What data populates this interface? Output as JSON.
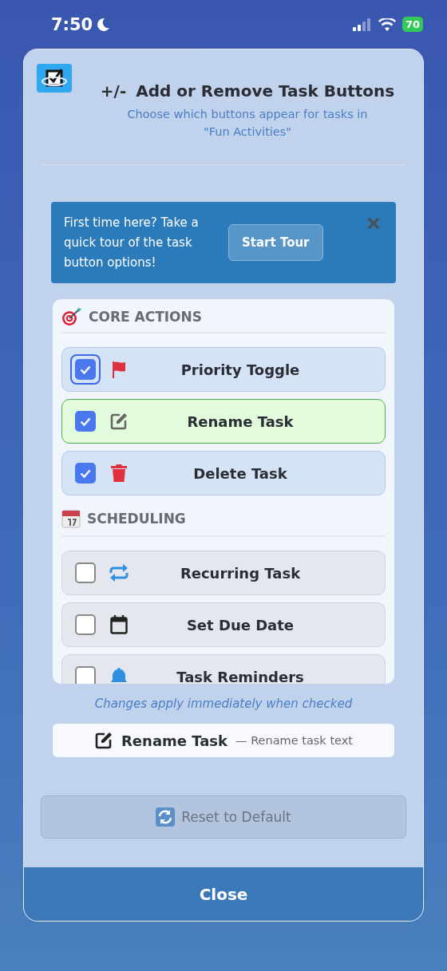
{
  "status_bar": {
    "time": "7:50",
    "battery": "70"
  },
  "dialog": {
    "title_prefix": "+/-",
    "title": "Add or Remove Task Buttons",
    "subtitle": "Choose which buttons appear for tasks in \"Fun Activities\""
  },
  "tour_banner": {
    "text": "First time here? Take a quick tour of the task button options!",
    "button": "Start Tour"
  },
  "sections": [
    {
      "title": "CORE ACTIONS",
      "items": [
        {
          "label": "Priority Toggle",
          "checked": true,
          "selected": false,
          "focused": true
        },
        {
          "label": "Rename Task",
          "checked": true,
          "selected": true,
          "focused": false
        },
        {
          "label": "Delete Task",
          "checked": true,
          "selected": false,
          "focused": false
        }
      ]
    },
    {
      "title": "SCHEDULING",
      "items": [
        {
          "label": "Recurring Task",
          "checked": false,
          "selected": false,
          "focused": false
        },
        {
          "label": "Set Due Date",
          "checked": false,
          "selected": false,
          "focused": false
        },
        {
          "label": "Task Reminders",
          "checked": false,
          "selected": false,
          "focused": false
        }
      ]
    }
  ],
  "hint": "Changes apply immediately when checked",
  "preview": {
    "name": "Rename Task",
    "description": "— Rename task text"
  },
  "reset_button": {
    "label": "Reset to Default",
    "disabled": true
  },
  "close_button": "Close"
}
